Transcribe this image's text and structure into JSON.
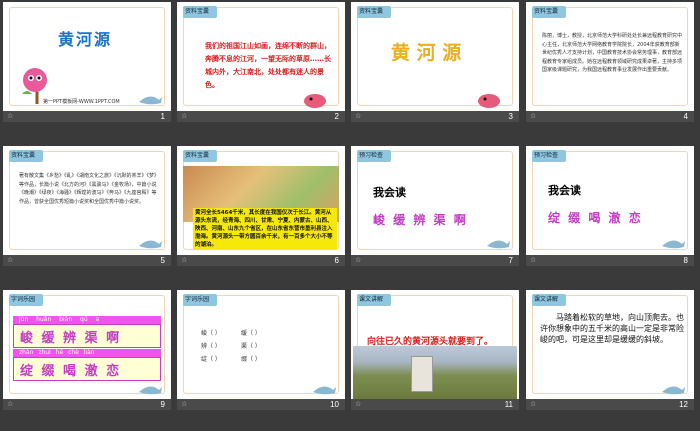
{
  "slides": [
    {
      "num": "1",
      "title": "黄河源",
      "footer": "第一PPT模板网-WWW.1PPT.COM"
    },
    {
      "num": "2",
      "tag": "资料宝囊",
      "text": "我们的祖国江山如画，连绵不断的群山，奔腾不息的江河，一望无际的草原……长城内外，大江南北，处处都有迷人的景色。"
    },
    {
      "num": "3",
      "tag": "资料宝囊",
      "title": "黄 河 源"
    },
    {
      "num": "4",
      "tag": "资料宝囊",
      "text": "陈丽，博士，教授，北京师范大学科研处处长兼远程教育研究中心主任，北京师范大学网络教育学院院长，2004年获教育部新世纪优秀人才支持计划，中国教育技术协会常务理事，教育部远程教育专家组成员。她在远程教育领域研究成果卓著，主持多项国家级课题研究，为我国远程教育事业发展作出重要贡献。"
    },
    {
      "num": "5",
      "tag": "资料宝囊",
      "text": "著有散文集《乡愁》《乱》《湖南文化之旅》《沉默的羔羊》《梦》等作品，长篇小说《北方的河》《黑骏马》《金牧场》，中篇小说《晚潮》《绿夜》《海骚》《辉煌的波马》《奔马》《九座宫殿》等作品，曾获全国优秀短篇小说奖和全国优秀中篇小说奖。"
    },
    {
      "num": "6",
      "tag": "资料宝囊",
      "text": "黄河全长5464千米，其长度在我国仅次于长江。黄河从源头东流，经青海、四川、甘肃、宁夏、内蒙古、山西、陕西、河南、山东九个省区，在山东省东营市垦利县注入渤海。黄河源头一带方圆百余千米，有一百多个大小不等的湖泊。"
    },
    {
      "num": "7",
      "tag": "预习检查",
      "heading": "我会读",
      "words": "峻 缓 辨 渠 啊"
    },
    {
      "num": "8",
      "tag": "预习检查",
      "heading": "我会读",
      "words": "绽 缀 喝 澈 恋"
    },
    {
      "num": "9",
      "tag": "字词乐园",
      "pinyin1": "jùn huǎn biàn qú a",
      "row1": "峻 缓 辨 渠 啊",
      "pinyin2": "zhàn zhuì hē chè liàn",
      "row2": "绽 缀 喝 澈 恋"
    },
    {
      "num": "10",
      "tag": "字词乐园",
      "compose": [
        [
          "峻（ ）",
          "缓（ ）"
        ],
        [
          "辨（ ）",
          "渠（ ）"
        ],
        [
          "绽（ ）",
          "缀（ ）"
        ]
      ]
    },
    {
      "num": "11",
      "tag": "课文讲解",
      "text": "向往已久的黄河源头就要到了。"
    },
    {
      "num": "12",
      "tag": "课文讲解",
      "text": "马踏着松软的草地，向山顶爬去。也许你想象中的五千米的高山一定是非常险峻的吧，可是这里却是缓缓的斜坡。"
    }
  ],
  "colors": {
    "accent": "#1a73c8",
    "red": "#d62020",
    "gold": "#e8b020",
    "bar": "#4a4a4a"
  }
}
